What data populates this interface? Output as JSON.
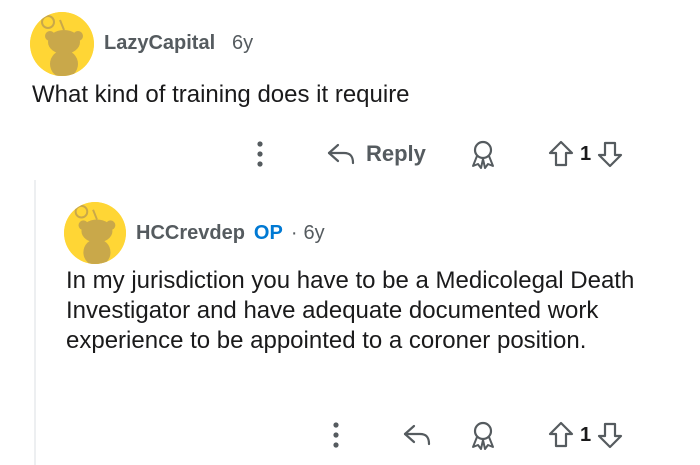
{
  "comments": [
    {
      "username": "LazyCapital",
      "age": "6y",
      "body": "What kind of training does it require",
      "avatar_icon": "snoo-avatar-icon",
      "actions": {
        "reply_label": "Reply",
        "vote_count": "1"
      }
    },
    {
      "username": "HCCrevdep",
      "op_badge": "OP",
      "separator": "·",
      "age": "6y",
      "body": "In my jurisdiction you have to be a Medicolegal Death Investigator and have adequate documented work experience to be appointed to a coroner position.",
      "avatar_icon": "snoo-avatar-icon",
      "actions": {
        "vote_count": "1"
      }
    }
  ],
  "colors": {
    "avatar_bg": "#ffd635",
    "op": "#0079d3",
    "meta": "#555b5f",
    "text": "#1a1a1b"
  }
}
